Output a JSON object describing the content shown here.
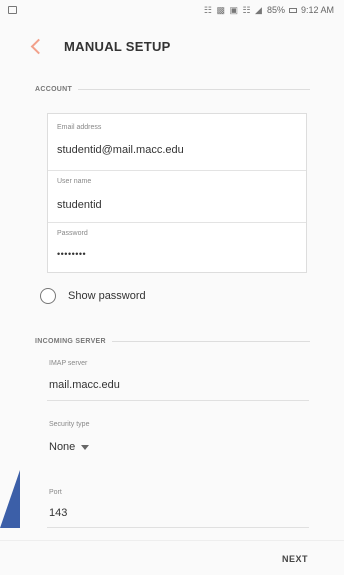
{
  "status_bar": {
    "left_icon": "gallery-icon",
    "icons": "☷ ▩ ▣ ☷ ◢",
    "battery": "85%",
    "time": "9:12 AM"
  },
  "header": {
    "title": "MANUAL SETUP",
    "back_icon": "chevron-left-icon",
    "back_color": "#f2a08a"
  },
  "account_section": {
    "label": "ACCOUNT",
    "fields": [
      {
        "label": "Email address",
        "value": "studentid@mail.macc.edu"
      },
      {
        "label": "User name",
        "value": "studentid"
      },
      {
        "label": "Password",
        "value": "••••••••"
      }
    ]
  },
  "show_password": {
    "label": "Show password",
    "checked": false
  },
  "incoming_section": {
    "label": "INCOMING SERVER",
    "imap_label": "IMAP server",
    "imap_value": "mail.macc.edu",
    "security_label": "Security type",
    "security_value": "None",
    "port_label": "Port",
    "port_value": "143"
  },
  "footer": {
    "next_label": "NEXT"
  },
  "colors": {
    "accent": "#f2a08a",
    "arrow": "#3c5fa8"
  }
}
